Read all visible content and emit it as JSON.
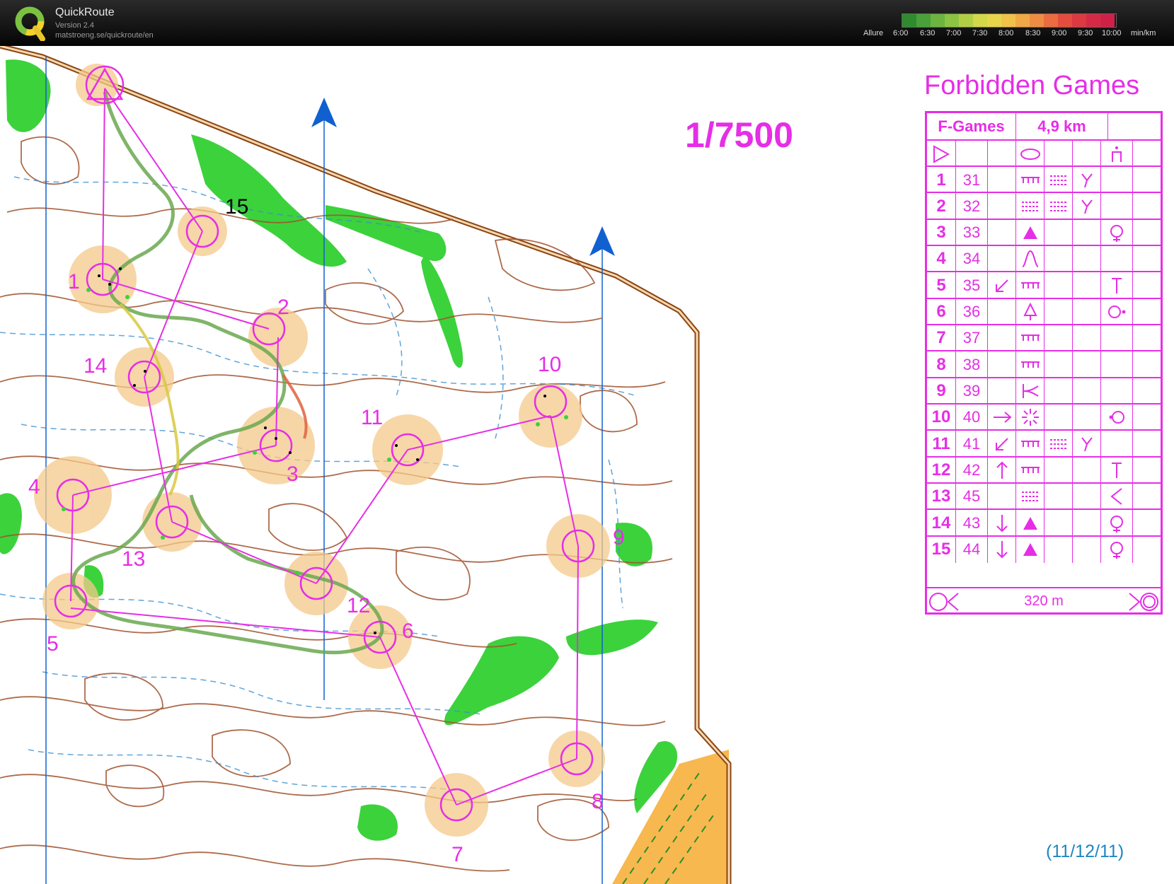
{
  "app": {
    "name": "QuickRoute",
    "version": "Version 2.4",
    "url": "matstroeng.se/quickroute/en"
  },
  "pace_scale": {
    "label": "Allure",
    "unit": "min/km",
    "ticks": [
      "6:00",
      "6:30",
      "7:00",
      "7:30",
      "8:00",
      "8:30",
      "9:00",
      "9:30",
      "10:00"
    ],
    "colors": [
      "#2e8b2e",
      "#4aa13a",
      "#6cb43f",
      "#8cc342",
      "#b1cf45",
      "#d2d84a",
      "#e7d54b",
      "#f0c24a",
      "#f2a846",
      "#ef8c43",
      "#ea6c40",
      "#e44d3e",
      "#dd3940",
      "#d52a45",
      "#cf2048"
    ]
  },
  "map": {
    "scale": "1/7500",
    "title": "Forbidden Games",
    "date": "(11/12/11)",
    "control_numbers": [
      "1",
      "2",
      "3",
      "4",
      "5",
      "6",
      "7",
      "8",
      "9",
      "10",
      "11",
      "12",
      "13",
      "14",
      "15"
    ],
    "colors": {
      "magenta": "#e62ee6",
      "contour": "#a0522d",
      "vegetation": "#3cd23c",
      "water": "#3a8fd0",
      "circle_bg": "#f4c98a",
      "arrow": "#1060d0"
    }
  },
  "description": {
    "event": "F-Games",
    "length": "4,9 km",
    "rows": [
      {
        "n": "1",
        "code": "31",
        "d": "",
        "e": "trench",
        "f": "marsh",
        "g": "fork",
        "h": ""
      },
      {
        "n": "2",
        "code": "32",
        "d": "",
        "e": "marsh",
        "f": "marsh",
        "g": "fork",
        "h": ""
      },
      {
        "n": "3",
        "code": "33",
        "d": "",
        "e": "boulder",
        "f": "",
        "g": "",
        "h": "foot"
      },
      {
        "n": "4",
        "code": "34",
        "d": "",
        "e": "knoll",
        "f": "",
        "g": "",
        "h": ""
      },
      {
        "n": "5",
        "code": "35",
        "d": "sw",
        "e": "trench",
        "f": "",
        "g": "",
        "h": "top"
      },
      {
        "n": "6",
        "code": "36",
        "d": "",
        "e": "tree",
        "f": "",
        "g": "",
        "h": "east"
      },
      {
        "n": "7",
        "code": "37",
        "d": "",
        "e": "trench",
        "f": "",
        "g": "",
        "h": ""
      },
      {
        "n": "8",
        "code": "38",
        "d": "",
        "e": "trench",
        "f": "",
        "g": "",
        "h": ""
      },
      {
        "n": "9",
        "code": "39",
        "d": "",
        "e": "rootstock",
        "f": "",
        "g": "",
        "h": ""
      },
      {
        "n": "10",
        "code": "40",
        "d": "east",
        "e": "rocky",
        "f": "",
        "g": "",
        "h": "west"
      },
      {
        "n": "11",
        "code": "41",
        "d": "sw",
        "e": "trench",
        "f": "marsh",
        "g": "fork",
        "h": ""
      },
      {
        "n": "12",
        "code": "42",
        "d": "north",
        "e": "trench",
        "f": "",
        "g": "",
        "h": "top"
      },
      {
        "n": "13",
        "code": "45",
        "d": "",
        "e": "marsh",
        "f": "",
        "g": "",
        "h": "corner"
      },
      {
        "n": "14",
        "code": "43",
        "d": "south",
        "e": "boulder",
        "f": "",
        "g": "",
        "h": "foot"
      },
      {
        "n": "15",
        "code": "44",
        "d": "south",
        "e": "boulder",
        "f": "",
        "g": "",
        "h": "foot"
      }
    ],
    "finish_distance": "320 m"
  }
}
